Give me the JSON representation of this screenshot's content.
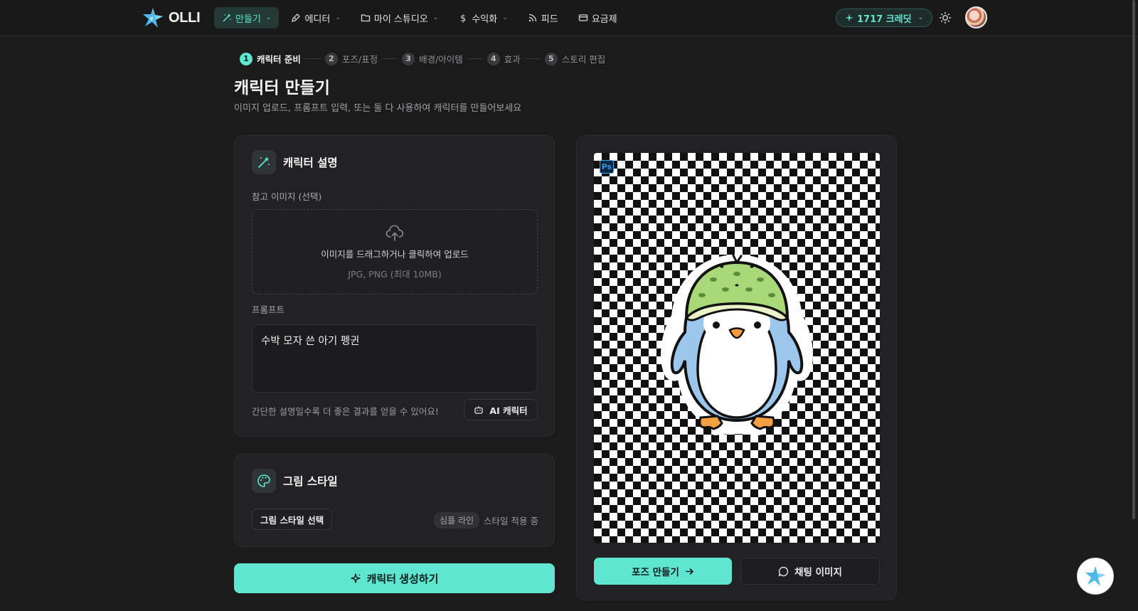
{
  "app": {
    "name": "OLLI"
  },
  "nav": {
    "items": [
      {
        "label": "만들기",
        "icon": "magic-wand-icon",
        "has_dropdown": true,
        "active": true
      },
      {
        "label": "에디터",
        "icon": "pen-tool-icon",
        "has_dropdown": true,
        "active": false
      },
      {
        "label": "마이 스튜디오",
        "icon": "folder-icon",
        "has_dropdown": true,
        "active": false
      },
      {
        "label": "수익화",
        "icon": "dollar-icon",
        "has_dropdown": true,
        "active": false
      },
      {
        "label": "피드",
        "icon": "rss-icon",
        "has_dropdown": false,
        "active": false
      },
      {
        "label": "요금제",
        "icon": "credit-card-icon",
        "has_dropdown": false,
        "active": false
      }
    ],
    "credits": "1717 크레딧",
    "theme_icon": "sun-icon"
  },
  "stepper": {
    "steps": [
      {
        "num": "1",
        "label": "캐릭터 준비",
        "active": true
      },
      {
        "num": "2",
        "label": "포즈/표정",
        "active": false
      },
      {
        "num": "3",
        "label": "배경/아이템",
        "active": false
      },
      {
        "num": "4",
        "label": "효과",
        "active": false
      },
      {
        "num": "5",
        "label": "스토리 편집",
        "active": false
      }
    ]
  },
  "page": {
    "title": "캐릭터 만들기",
    "subtitle": "이미지 업로드, 프롬프트 입력, 또는 둘 다 사용하여 캐릭터를 만들어보세요"
  },
  "description_card": {
    "title": "캐릭터 설명",
    "reference_label": "참고 이미지 (선택)",
    "upload_text": "이미지를 드래그하거나 클릭하여 업로드",
    "upload_formats": "JPG, PNG (최대 10MB)",
    "prompt_label": "프롬프트",
    "prompt_value": "수박 모자 쓴 아기 펭귄",
    "hint": "간단한 설명일수록 더 좋은 결과를 얻을 수 있어요!",
    "ai_button": "AI 캐릭터"
  },
  "style_card": {
    "title": "그림 스타일",
    "select_label": "그림 스타일 선택",
    "chip": "심플 라인",
    "status": "스타일 적용 중"
  },
  "generate_button": "캐릭터 생성하기",
  "preview": {
    "ps_badge": "Ps",
    "pose_button": "포즈 만들기",
    "chat_button": "채팅 이미지"
  },
  "colors": {
    "accent": "#5ee6d0",
    "background": "#1b1b1c",
    "card": "#222224"
  }
}
